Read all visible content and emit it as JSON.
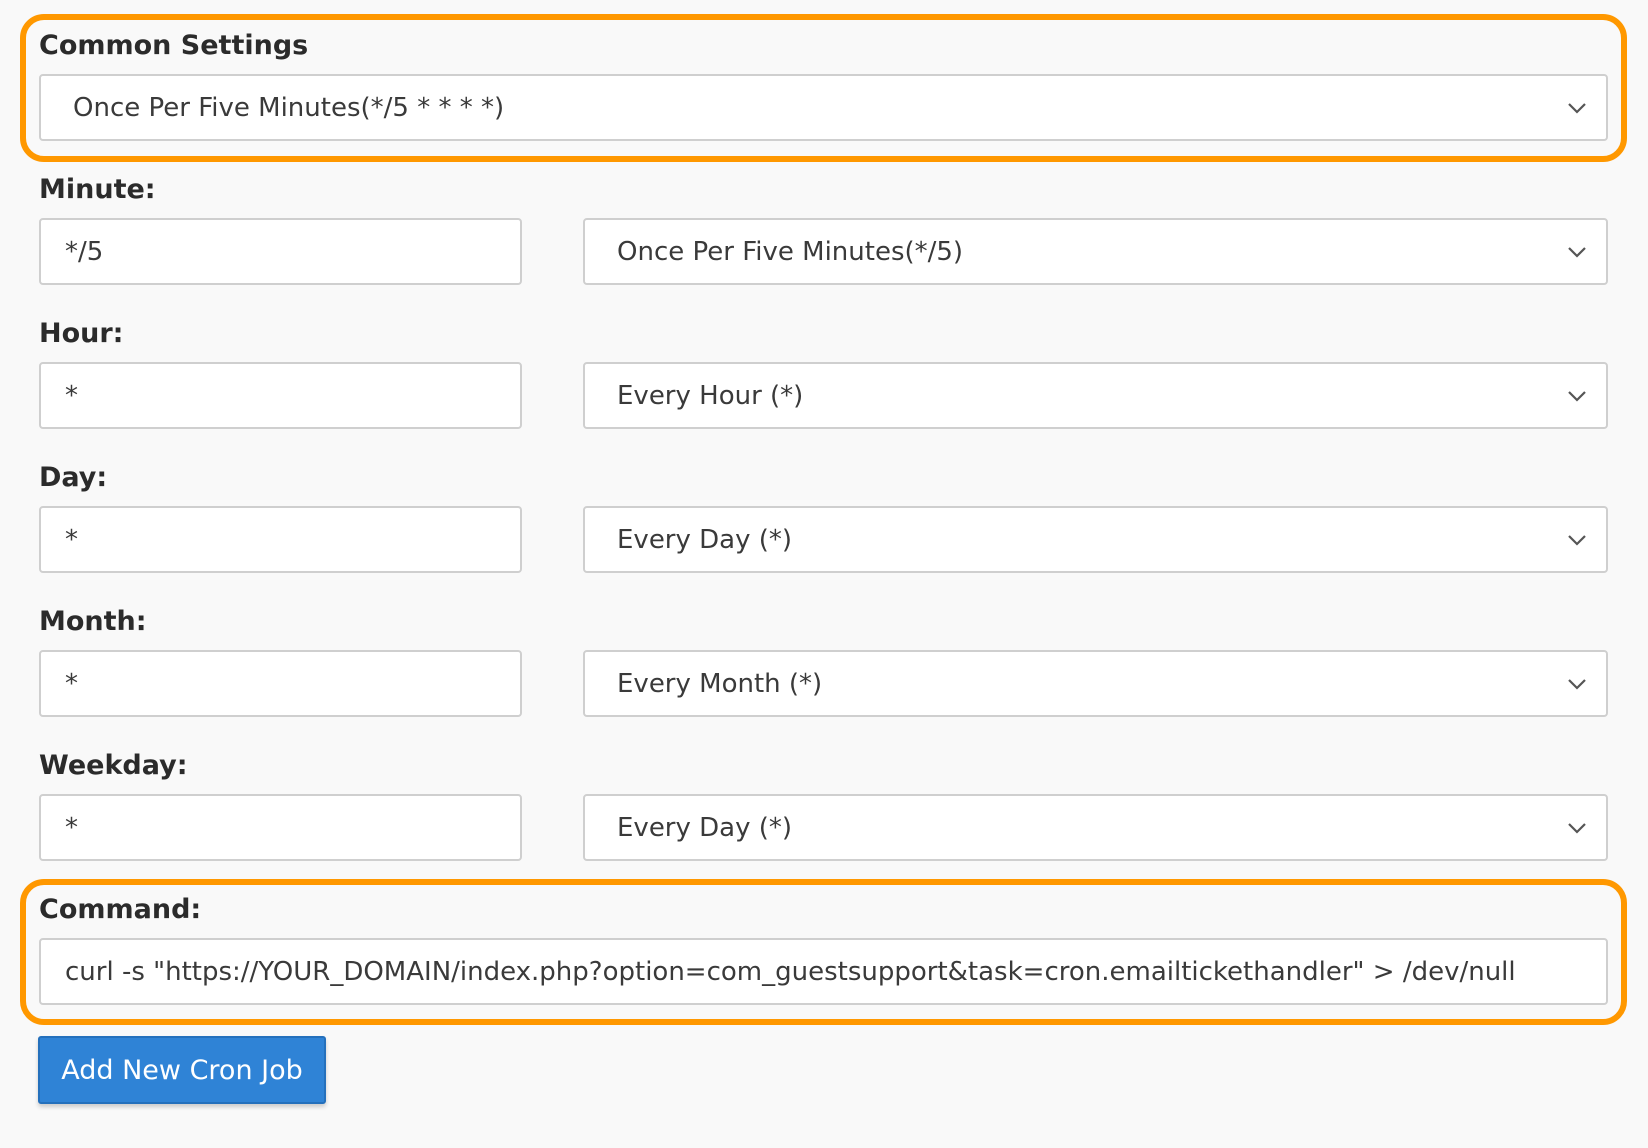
{
  "common_settings": {
    "label": "Common Settings",
    "selected": "Once Per Five Minutes(*/5 * * * *)"
  },
  "minute": {
    "label": "Minute:",
    "value": "*/5",
    "selected": "Once Per Five Minutes(*/5)"
  },
  "hour": {
    "label": "Hour:",
    "value": "*",
    "selected": "Every Hour (*)"
  },
  "day": {
    "label": "Day:",
    "value": "*",
    "selected": "Every Day (*)"
  },
  "month": {
    "label": "Month:",
    "value": "*",
    "selected": "Every Month (*)"
  },
  "weekday": {
    "label": "Weekday:",
    "value": "*",
    "selected": "Every Day (*)"
  },
  "command": {
    "label": "Command:",
    "value": "curl -s \"https://YOUR_DOMAIN/index.php?option=com_guestsupport&task=cron.emailtickethandler\" > /dev/null"
  },
  "add_button": {
    "label": "Add New Cron Job"
  },
  "colors": {
    "highlight": "#ff9800",
    "button": "#2f83d6",
    "background": "#f9f9f9"
  }
}
